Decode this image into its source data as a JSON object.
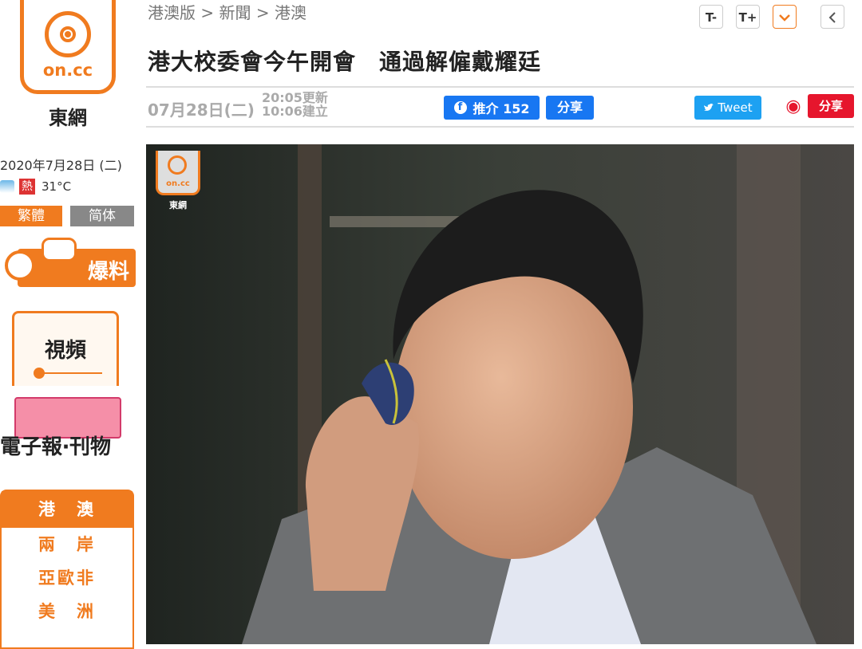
{
  "sidebar": {
    "logo_text": "on.cc",
    "logo_name": "東網",
    "date": "2020年7月28日 (二)",
    "weather_badge": "熱",
    "temperature": "31°C",
    "lang_traditional": "繁體",
    "lang_simplified": "简体",
    "tip_label": "爆料",
    "video_label": "視頻",
    "epaper_label": "電子報‧刊物",
    "regions": [
      "港　澳",
      "兩　岸",
      "亞歐非",
      "美　洲"
    ]
  },
  "header": {
    "breadcrumb": "港澳版 > 新聞 > 港澳",
    "font_smaller": "T-",
    "font_larger": "T+"
  },
  "article": {
    "title": "港大校委會今午開會　通過解僱戴耀廷",
    "date": "07月28日(二)",
    "updated": "20:05更新",
    "created": "10:06建立",
    "fb_like": "推介 152",
    "fb_share": "分享",
    "tweet": "Tweet",
    "weibo_share": "分享",
    "photo_watermark_logo": "on.cc",
    "photo_watermark_name": "東網"
  },
  "colors": {
    "brand_orange": "#f07b1f",
    "facebook_blue": "#1877f2",
    "twitter_blue": "#1da1f2",
    "weibo_red": "#e6162d"
  }
}
